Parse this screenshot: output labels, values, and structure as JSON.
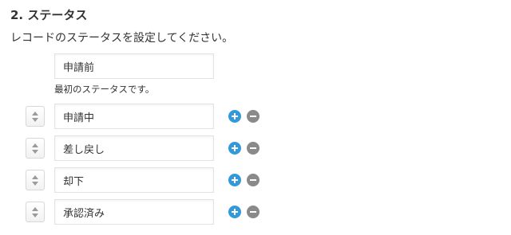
{
  "section": {
    "title": "2. ステータス",
    "description": "レコードのステータスを設定してください。"
  },
  "first_status": {
    "value": "申請前",
    "hint": "最初のステータスです。"
  },
  "statuses": [
    {
      "value": "申請中"
    },
    {
      "value": "差し戻し"
    },
    {
      "value": "却下"
    },
    {
      "value": "承認済み"
    }
  ],
  "icons": {
    "sort": "sort-arrows-icon",
    "add": "plus-circle-icon",
    "remove": "minus-circle-icon"
  },
  "colors": {
    "add_button": "#3498db",
    "remove_button": "#8a8a8a"
  }
}
